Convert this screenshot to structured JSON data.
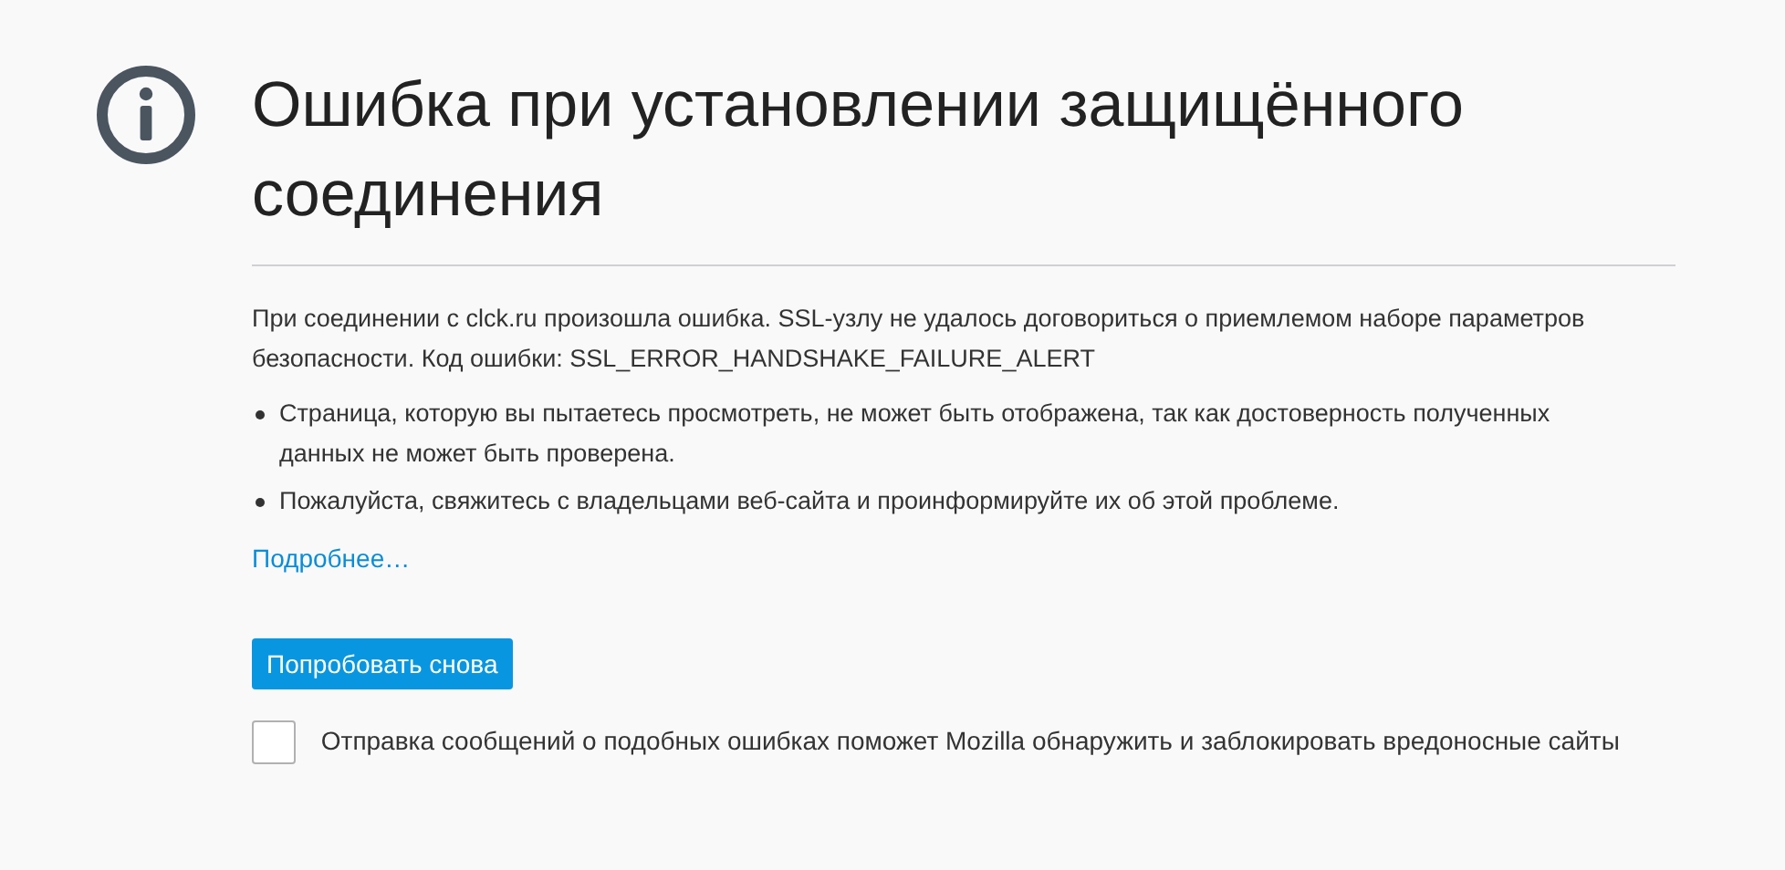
{
  "title": "Ошибка при установлении защищённого соединения",
  "description": "При соединении с clck.ru произошла ошибка. SSL-узлу не удалось договориться о приемлемом наборе параметров безопасности. Код ошибки: SSL_ERROR_HANDSHAKE_FAILURE_ALERT",
  "bullets": [
    "Страница, которую вы пытаетесь просмотреть, не может быть отображена, так как достоверность полученных данных не может быть проверена.",
    "Пожалуйста, свяжитесь с владельцами веб-сайта и проинформируйте их об этой проблеме."
  ],
  "advanced_link": "Подробнее…",
  "retry_button": "Попробовать снова",
  "report": {
    "checked": false,
    "label": "Отправка сообщений о подобных ошибках поможет Mozilla обнаружить и заблокировать вредоносные сайты"
  }
}
